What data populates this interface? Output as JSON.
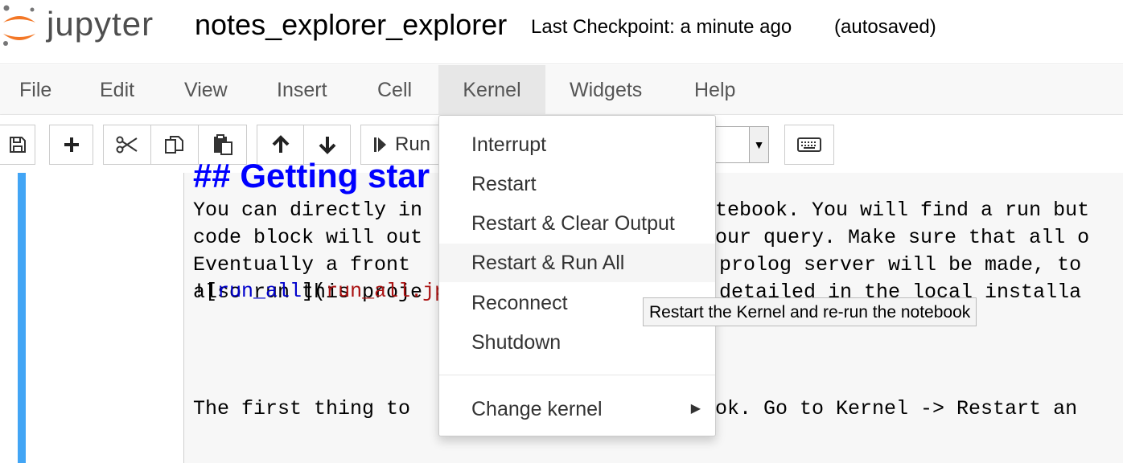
{
  "header": {
    "logo_text": "jupyter",
    "notebook_name": "notes_explorer_explorer",
    "checkpoint": "Last Checkpoint: a minute ago",
    "autosave": "(autosaved)"
  },
  "menubar": {
    "items": [
      "File",
      "Edit",
      "View",
      "Insert",
      "Cell",
      "Kernel",
      "Widgets",
      "Help"
    ],
    "open_menu": "Kernel"
  },
  "toolbar": {
    "run_label": "Run",
    "buttons": [
      "save-icon",
      "plus-icon",
      "cut-icon",
      "copy-icon",
      "paste-icon",
      "arrow-up-icon",
      "arrow-down-icon",
      "run-icon",
      "keyboard-icon"
    ],
    "cell_type": ""
  },
  "kernel_menu": {
    "items": [
      "Interrupt",
      "Restart",
      "Restart & Clear Output",
      "Restart & Run All",
      "Reconnect",
      "Shutdown"
    ],
    "change_kernel": "Change kernel",
    "hovered": "Restart & Run All"
  },
  "tooltip": "Restart the Kernel and re-run the notebook",
  "cell": {
    "lines": [
      "You can directly in",
      "code block will out",
      "Eventually a front",
      "also run this proje"
    ],
    "lines_right": [
      "tebook. You will find a run but",
      "our query. Make sure that all o",
      "prolog server will be made, to",
      "detailed in the local installa"
    ],
    "heading": "## Getting star",
    "line2_left": "The first thing to",
    "line2_right": "ok. Go to Kernel -> Restart an",
    "link_open": "![",
    "link_text": "run_all",
    "link_mid": "](",
    "link_url": "run_all.jpg",
    "link_close": ")"
  }
}
